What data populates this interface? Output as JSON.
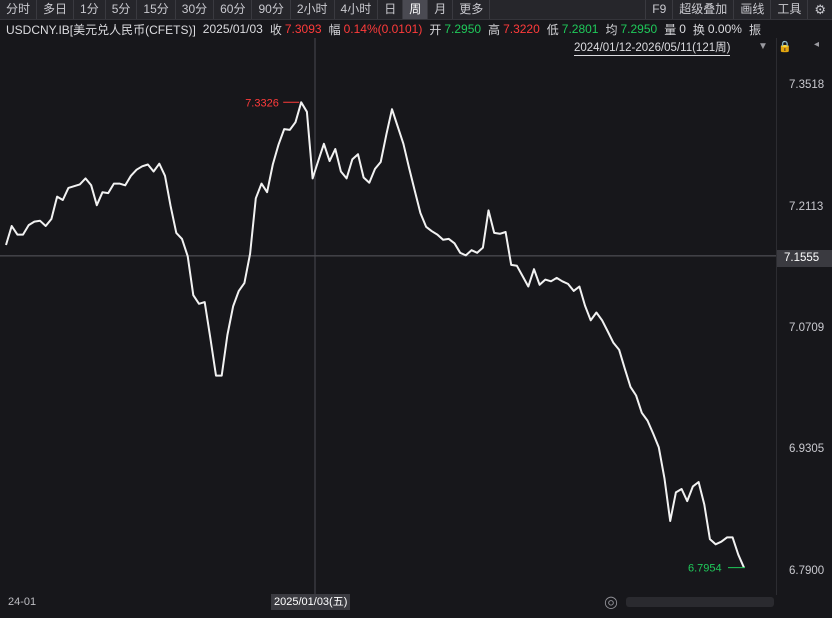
{
  "toolbar": {
    "periods": [
      "分时",
      "多日",
      "1分",
      "5分",
      "15分",
      "30分",
      "60分",
      "90分",
      "2小时",
      "4小时",
      "日",
      "周",
      "月",
      "更多"
    ],
    "active_period": "周",
    "tools": [
      "F9",
      "超级叠加",
      "画线",
      "工具"
    ],
    "settings_icon": "gear-icon"
  },
  "info": {
    "symbol": "USDCNY.IB[美元兑人民币(CFETS)]",
    "date": "2025/01/03",
    "close_label": "收",
    "close": "7.3093",
    "change_label": "幅",
    "change": "0.14%(0.0101)",
    "open_label": "开",
    "open": "7.2950",
    "high_label": "高",
    "high": "7.3220",
    "low_label": "低",
    "low": "7.2801",
    "avg_label": "均",
    "avg": "7.2950",
    "volume_label": "量",
    "volume": "0",
    "turnover_label": "换",
    "turnover": "0.00%",
    "extra_label": "振"
  },
  "range": {
    "label": "2024/01/12-2026/05/11(121周)"
  },
  "y_axis_ticks": [
    "7.3518",
    "7.2113",
    "7.0709",
    "6.9305",
    "6.7900"
  ],
  "current_price": "7.1555",
  "max_marker": "7.3326",
  "min_marker": "6.7954",
  "x_axis": {
    "start": "24-01",
    "cursor": "2025/01/03(五)"
  },
  "chart_data": {
    "type": "line",
    "x_start": "2024-01-12",
    "x_end": "2026-05-11",
    "ylim": [
      6.79,
      7.3518
    ],
    "y_ticks": [
      7.3518,
      7.2113,
      7.0709,
      6.9305,
      6.79
    ],
    "crosshair_y": 7.1555,
    "max": 7.3326,
    "min": 6.7954,
    "values": [
      7.168,
      7.19,
      7.18,
      7.18,
      7.191,
      7.195,
      7.196,
      7.19,
      7.198,
      7.224,
      7.22,
      7.234,
      7.236,
      7.238,
      7.245,
      7.237,
      7.214,
      7.229,
      7.228,
      7.239,
      7.239,
      7.237,
      7.248,
      7.255,
      7.259,
      7.261,
      7.253,
      7.262,
      7.248,
      7.213,
      7.182,
      7.175,
      7.155,
      7.11,
      7.1,
      7.102,
      7.06,
      7.017,
      7.017,
      7.064,
      7.097,
      7.115,
      7.124,
      7.158,
      7.222,
      7.239,
      7.229,
      7.261,
      7.284,
      7.302,
      7.301,
      7.31,
      7.333,
      7.322,
      7.245,
      7.265,
      7.285,
      7.265,
      7.279,
      7.253,
      7.245,
      7.267,
      7.273,
      7.246,
      7.24,
      7.256,
      7.264,
      7.296,
      7.325,
      7.305,
      7.285,
      7.257,
      7.231,
      7.205,
      7.189,
      7.184,
      7.18,
      7.174,
      7.175,
      7.17,
      7.159,
      7.156,
      7.162,
      7.159,
      7.165,
      7.208,
      7.182,
      7.181,
      7.183,
      7.145,
      7.144,
      7.132,
      7.12,
      7.14,
      7.122,
      7.128,
      7.126,
      7.13,
      7.126,
      7.123,
      7.115,
      7.12,
      7.098,
      7.081,
      7.09,
      7.081,
      7.068,
      7.055,
      7.047,
      7.025,
      7.004,
      6.994,
      6.974,
      6.965,
      6.95,
      6.934,
      6.898,
      6.849,
      6.882,
      6.886,
      6.872,
      6.889,
      6.894,
      6.868,
      6.828,
      6.822,
      6.825,
      6.83,
      6.83,
      6.81,
      6.795
    ]
  }
}
